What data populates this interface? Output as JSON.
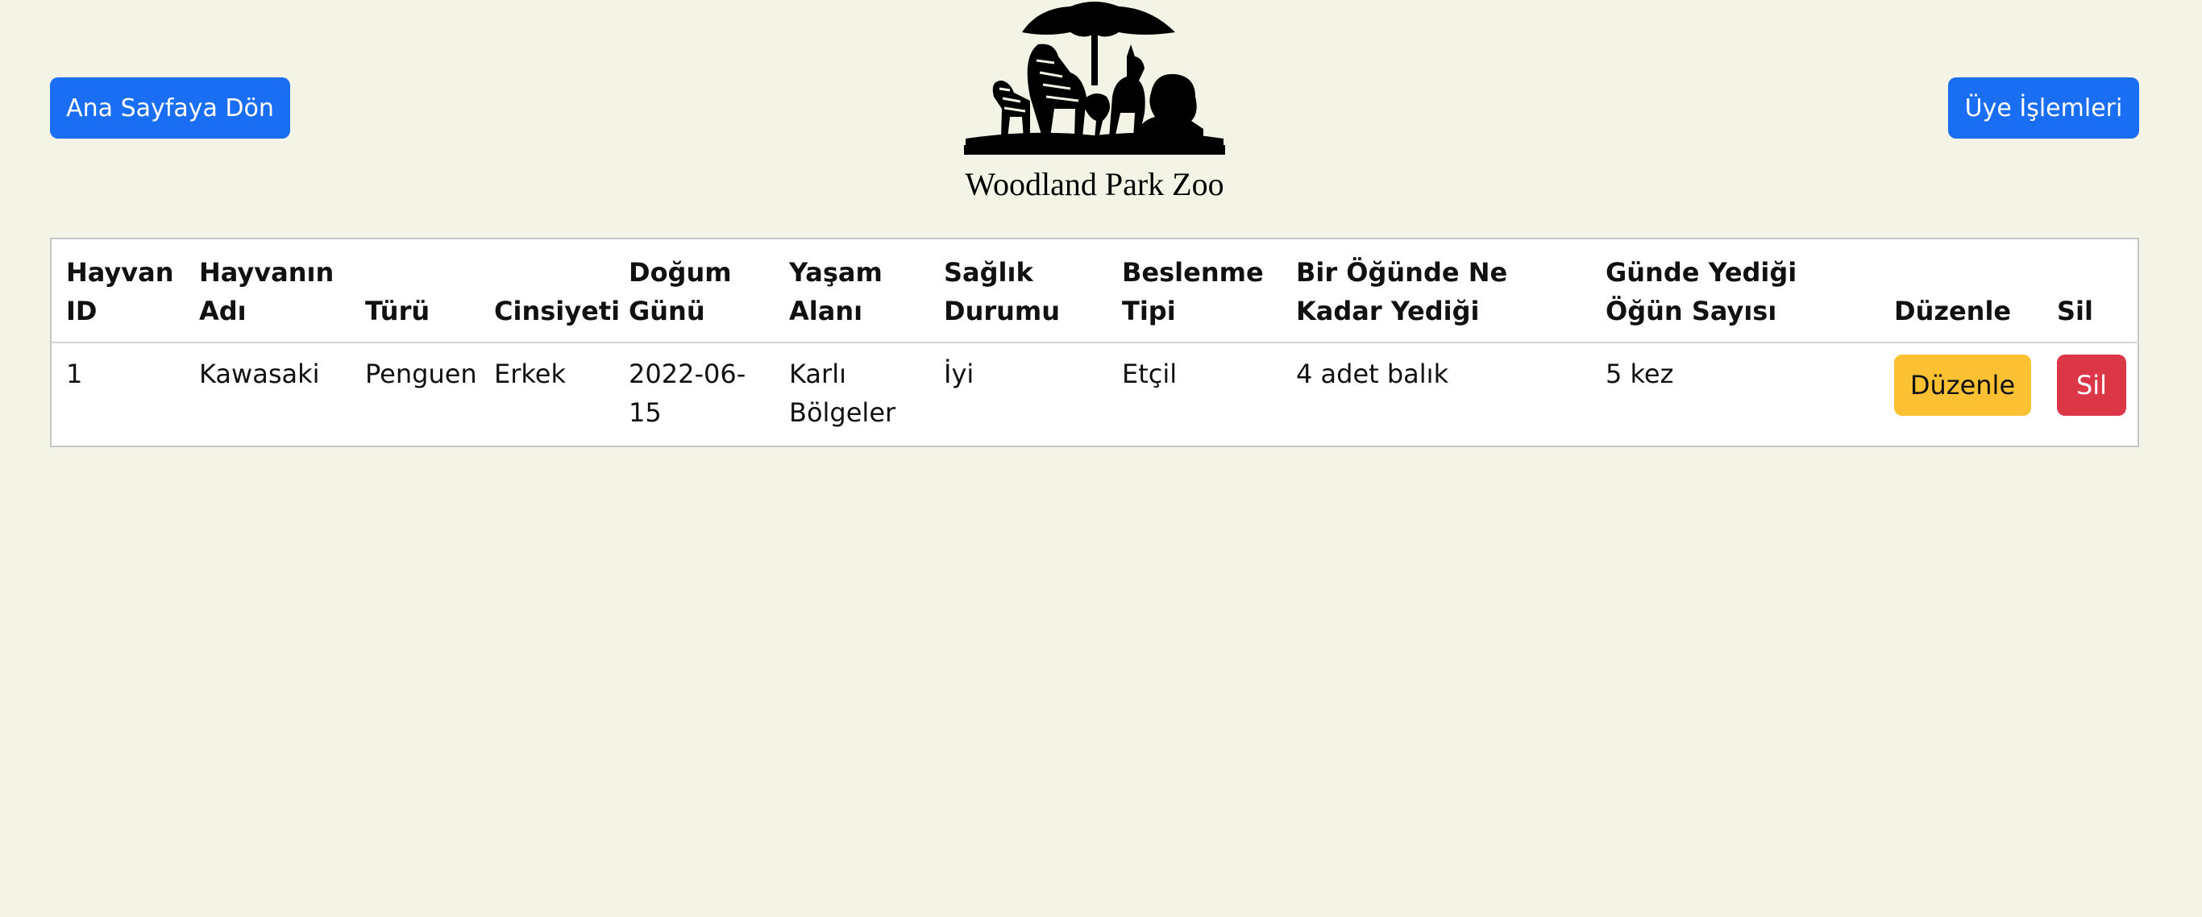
{
  "nav": {
    "home_label": "Ana Sayfaya Dön",
    "members_label": "Üye İşlemleri"
  },
  "logo": {
    "text": "Woodland Park Zoo",
    "icon": "zoo-animals-silhouette-logo"
  },
  "table": {
    "headers": {
      "id": "Hayvan ID",
      "name": "Hayvanın Adı",
      "species": "Türü",
      "gender": "Cinsiyeti",
      "birthday": "Doğum Günü",
      "habitat": "Yaşam Alanı",
      "health": "Sağlık Durumu",
      "diet": "Beslenme Tipi",
      "portion": "Bir Öğünde Ne Kadar Yediği",
      "meals": "Günde Yediği Öğün Sayısı",
      "edit": "Düzenle",
      "delete": "Sil"
    },
    "rows": [
      {
        "id": "1",
        "name": "Kawasaki",
        "species": "Penguen",
        "gender": "Erkek",
        "birthday": "2022-06-15",
        "habitat": "Karlı Bölgeler",
        "health": "İyi",
        "diet": "Etçil",
        "portion": "4 adet balık",
        "meals": "5 kez",
        "edit_label": "Düzenle",
        "delete_label": "Sil"
      }
    ]
  },
  "colors": {
    "background": "#f4f4e6",
    "primary": "#1a6ef3",
    "warning": "#fcc033",
    "danger": "#dc3747"
  }
}
